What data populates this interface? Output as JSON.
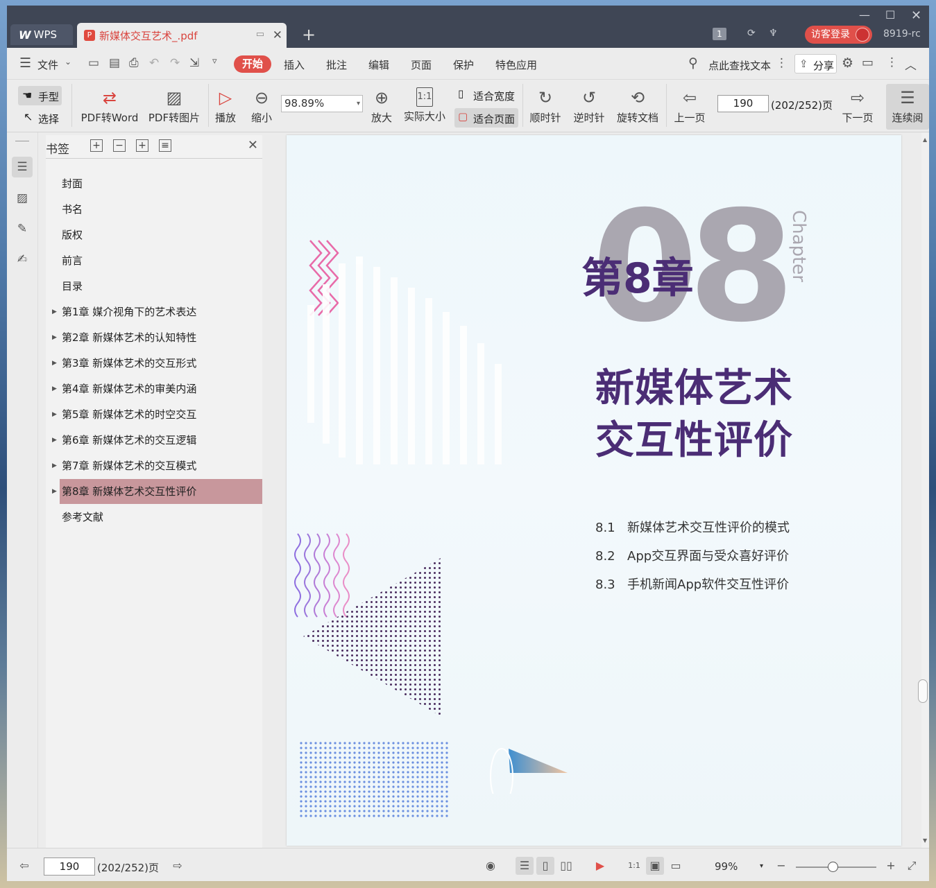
{
  "app": {
    "name": "WPS",
    "user": "8919-rc",
    "login_label": "访客登录",
    "tab_count_badge": "1"
  },
  "document": {
    "tab_title": "新媒体交互艺术_.pdf"
  },
  "menu": {
    "file": "文件",
    "start": "开始",
    "items": [
      "插入",
      "批注",
      "编辑",
      "页面",
      "保护",
      "特色应用"
    ],
    "search": "点此查找文本",
    "share": "分享"
  },
  "ribbon": {
    "hand": "手型",
    "select": "选择",
    "pdf_to_word": "PDF转Word",
    "pdf_to_image": "PDF转图片",
    "play": "播放",
    "zoom_out": "缩小",
    "zoom_value": "98.89%",
    "zoom_in": "放大",
    "actual_size": "实际大小",
    "fit_width": "适合宽度",
    "fit_page": "适合页面",
    "clockwise": "顺时针",
    "counter_clockwise": "逆时针",
    "rotate_doc": "旋转文档",
    "prev_page": "上一页",
    "page_input": "190",
    "page_info": "(202/252)页",
    "next_page": "下一页",
    "continuous": "连续阅"
  },
  "bookmarks": {
    "title": "书签",
    "items": [
      {
        "label": "封面",
        "expandable": false
      },
      {
        "label": "书名",
        "expandable": false
      },
      {
        "label": "版权",
        "expandable": false
      },
      {
        "label": "前言",
        "expandable": false
      },
      {
        "label": "目录",
        "expandable": false
      },
      {
        "label": "第1章 媒介视角下的艺术表达",
        "expandable": true
      },
      {
        "label": "第2章 新媒体艺术的认知特性",
        "expandable": true
      },
      {
        "label": "第3章 新媒体艺术的交互形式",
        "expandable": true
      },
      {
        "label": "第4章 新媒体艺术的审美内涵",
        "expandable": true
      },
      {
        "label": "第5章 新媒体艺术的时空交互",
        "expandable": true
      },
      {
        "label": "第6章 新媒体艺术的交互逻辑",
        "expandable": true
      },
      {
        "label": "第7章 新媒体艺术的交互模式",
        "expandable": true
      },
      {
        "label": "第8章 新媒体艺术交互性评价",
        "expandable": true,
        "selected": true
      },
      {
        "label": "参考文献",
        "expandable": false
      }
    ]
  },
  "page": {
    "chapter_number": "08",
    "chapter_word": "Chapter",
    "chapter_label": "第8章",
    "title_line1": "新媒体艺术",
    "title_line2": "交互性评价",
    "toc": [
      {
        "num": "8.1",
        "text": "新媒体艺术交互性评价的模式"
      },
      {
        "num": "8.2",
        "text": "App交互界面与受众喜好评价"
      },
      {
        "num": "8.3",
        "text": "手机新闻App软件交互性评价"
      }
    ]
  },
  "status": {
    "page_input": "190",
    "page_info": "(202/252)页",
    "zoom": "99%"
  },
  "colors": {
    "accent": "#e0504a",
    "title_purple": "#4b2d75",
    "selected_bookmark": "#c8979c",
    "titlebar": "#3f4655"
  }
}
